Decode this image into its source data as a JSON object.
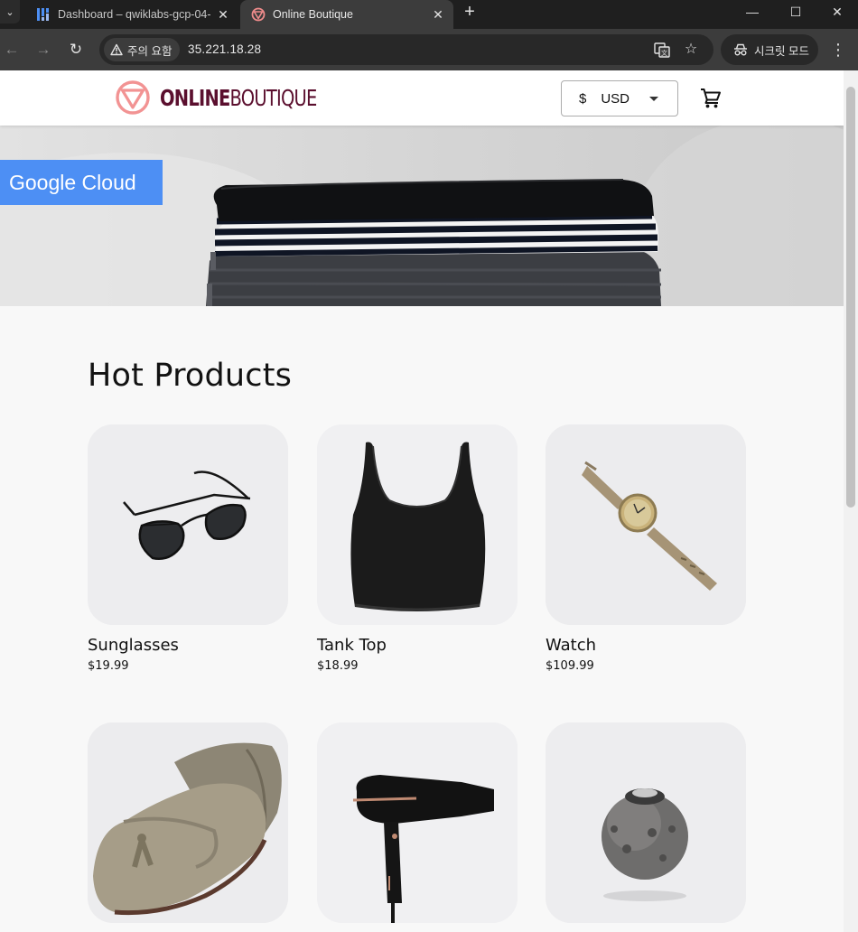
{
  "browser": {
    "tabs": [
      {
        "title": "Dashboard – qwiklabs-gcp-04-",
        "active": false
      },
      {
        "title": "Online Boutique",
        "active": true
      }
    ],
    "security_label": "주의 요함",
    "url": "35.221.18.28",
    "incognito_label": "시크릿 모드"
  },
  "site": {
    "logo_bold": "ONLINE",
    "logo_light": "BOUTIQUE",
    "currency_symbol": "$",
    "currency_code": "USD",
    "brand_color": "#5b0f2e",
    "accent_color": "#4d8ff4"
  },
  "hero": {
    "badge": "Google Cloud"
  },
  "section": {
    "title": "Hot Products"
  },
  "products": [
    {
      "name": "Sunglasses",
      "price": "$19.99",
      "icon": "sunglasses"
    },
    {
      "name": "Tank Top",
      "price": "$18.99",
      "icon": "tank-top"
    },
    {
      "name": "Watch",
      "price": "$109.99",
      "icon": "watch"
    },
    {
      "name": "",
      "price": "",
      "icon": "loafers"
    },
    {
      "name": "",
      "price": "",
      "icon": "hair-dryer"
    },
    {
      "name": "",
      "price": "",
      "icon": "candle-holder"
    }
  ]
}
